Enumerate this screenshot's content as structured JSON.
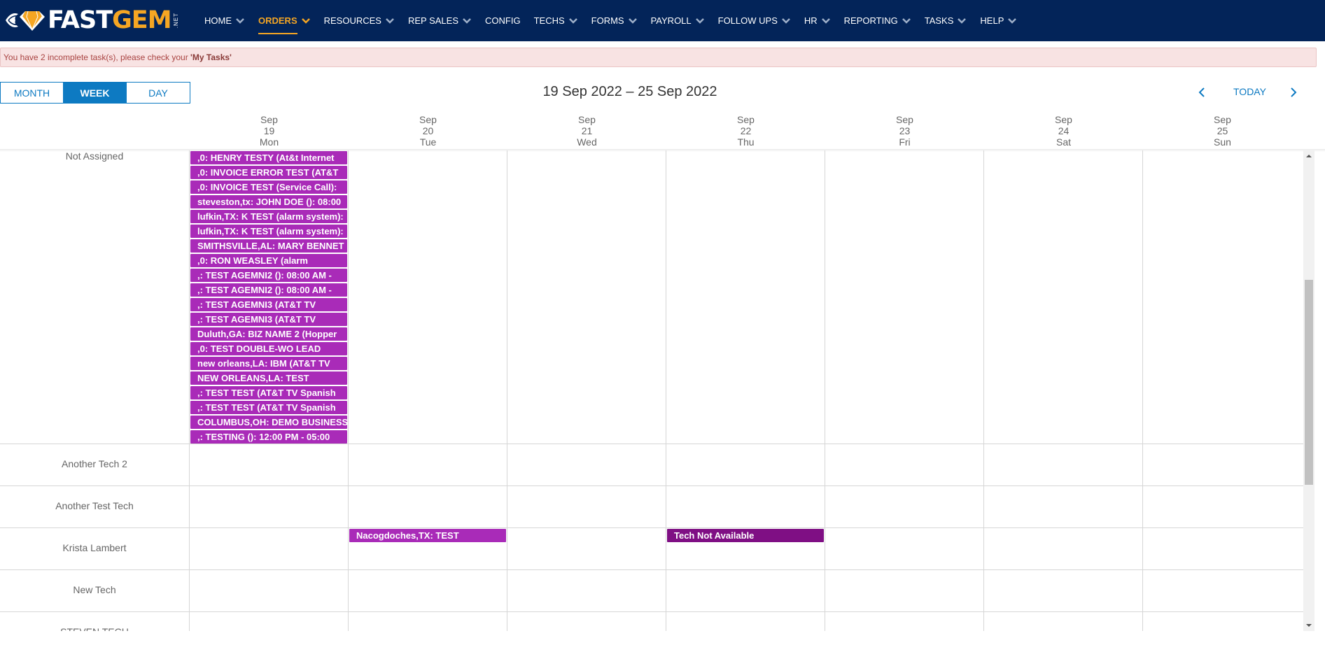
{
  "logo": {
    "part1": "FAST",
    "part2": "GEM",
    "suffix": ".NET"
  },
  "nav": [
    {
      "label": "HOME",
      "active": false,
      "dropdown": true
    },
    {
      "label": "ORDERS",
      "active": true,
      "dropdown": true
    },
    {
      "label": "RESOURCES",
      "active": false,
      "dropdown": true
    },
    {
      "label": "REP SALES",
      "active": false,
      "dropdown": true
    },
    {
      "label": "CONFIG",
      "active": false,
      "dropdown": false
    },
    {
      "label": "TECHS",
      "active": false,
      "dropdown": true
    },
    {
      "label": "FORMS",
      "active": false,
      "dropdown": true
    },
    {
      "label": "PAYROLL",
      "active": false,
      "dropdown": true
    },
    {
      "label": "FOLLOW UPS",
      "active": false,
      "dropdown": true
    },
    {
      "label": "HR",
      "active": false,
      "dropdown": true
    },
    {
      "label": "REPORTING",
      "active": false,
      "dropdown": true
    },
    {
      "label": "TASKS",
      "active": false,
      "dropdown": true
    },
    {
      "label": "HELP",
      "active": false,
      "dropdown": true
    }
  ],
  "alert": {
    "prefix": "You have 2 incomplete task(s), please check your ",
    "link": "'My Tasks'"
  },
  "views": [
    {
      "label": "MONTH",
      "active": false
    },
    {
      "label": "WEEK",
      "active": true
    },
    {
      "label": "DAY",
      "active": false
    }
  ],
  "date_range": "19 Sep 2022 – 25 Sep 2022",
  "today_label": "TODAY",
  "days": [
    {
      "month": "Sep",
      "date": "19",
      "weekday": "Mon"
    },
    {
      "month": "Sep",
      "date": "20",
      "weekday": "Tue"
    },
    {
      "month": "Sep",
      "date": "21",
      "weekday": "Wed"
    },
    {
      "month": "Sep",
      "date": "22",
      "weekday": "Thu"
    },
    {
      "month": "Sep",
      "date": "23",
      "weekday": "Fri"
    },
    {
      "month": "Sep",
      "date": "24",
      "weekday": "Sat"
    },
    {
      "month": "Sep",
      "date": "25",
      "weekday": "Sun"
    }
  ],
  "colors": {
    "navbar": "#032459",
    "accent": "#f5a623",
    "primary": "#0d7ac2",
    "event": "#a92bb8",
    "event_dark": "#7f0f84"
  },
  "rows": [
    {
      "label": "Not Assigned",
      "events": [
        {
          "day": 0,
          "title": ",0: HENRY TESTY (At&t Internet"
        },
        {
          "day": 0,
          "title": ",0: INVOICE ERROR TEST (AT&T"
        },
        {
          "day": 0,
          "title": ",0: INVOICE TEST (Service Call):"
        },
        {
          "day": 0,
          "title": "steveston,tx: JOHN DOE (): 08:00"
        },
        {
          "day": 0,
          "title": "lufkin,TX: K TEST (alarm system):"
        },
        {
          "day": 0,
          "title": "lufkin,TX: K TEST (alarm system):"
        },
        {
          "day": 0,
          "title": "SMITHSVILLE,AL: MARY BENNET"
        },
        {
          "day": 0,
          "title": ",0: RON WEASLEY (alarm"
        },
        {
          "day": 0,
          "title": ",: TEST AGEMNI2 (): 08:00 AM -"
        },
        {
          "day": 0,
          "title": ",: TEST AGEMNI2 (): 08:00 AM -"
        },
        {
          "day": 0,
          "title": ",: TEST AGEMNI3 (AT&T TV"
        },
        {
          "day": 0,
          "title": ",: TEST AGEMNI3 (AT&T TV"
        },
        {
          "day": 0,
          "title": "Duluth,GA: BIZ NAME 2 (Hopper"
        },
        {
          "day": 0,
          "title": ",0: TEST DOUBLE-WO LEAD"
        },
        {
          "day": 0,
          "title": "new orleans,LA: IBM (AT&T TV"
        },
        {
          "day": 0,
          "title": "NEW ORLEANS,LA: TEST"
        },
        {
          "day": 0,
          "title": ",: TEST TEST (AT&T TV Spanish"
        },
        {
          "day": 0,
          "title": ",: TEST TEST (AT&T TV Spanish"
        },
        {
          "day": 0,
          "title": "COLUMBUS,OH: DEMO BUSINESS"
        },
        {
          "day": 0,
          "title": ",: TESTING (): 12:00 PM - 05:00"
        }
      ]
    },
    {
      "label": "Another Tech 2",
      "events": []
    },
    {
      "label": "Another Test Tech",
      "events": []
    },
    {
      "label": "Krista Lambert",
      "events": [
        {
          "day": 1,
          "title": "Nacogdoches,TX: TEST"
        },
        {
          "day": 3,
          "title": "Tech Not Available",
          "dark": true
        }
      ]
    },
    {
      "label": "New Tech",
      "events": []
    },
    {
      "label": "STEVEN TECH",
      "events": []
    }
  ]
}
